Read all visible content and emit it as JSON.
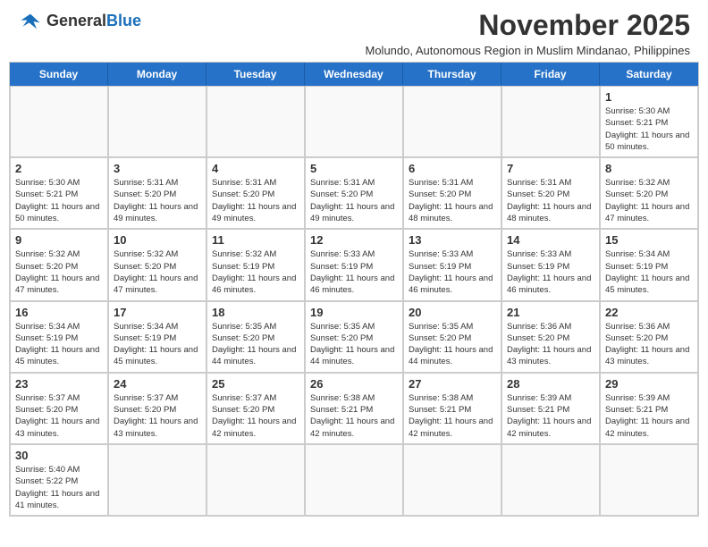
{
  "header": {
    "logo_general": "General",
    "logo_blue": "Blue",
    "month_title": "November 2025",
    "subtitle": "Molundo, Autonomous Region in Muslim Mindanao, Philippines"
  },
  "day_headers": [
    "Sunday",
    "Monday",
    "Tuesday",
    "Wednesday",
    "Thursday",
    "Friday",
    "Saturday"
  ],
  "weeks": [
    [
      {
        "day": "",
        "info": ""
      },
      {
        "day": "",
        "info": ""
      },
      {
        "day": "",
        "info": ""
      },
      {
        "day": "",
        "info": ""
      },
      {
        "day": "",
        "info": ""
      },
      {
        "day": "",
        "info": ""
      },
      {
        "day": "1",
        "info": "Sunrise: 5:30 AM\nSunset: 5:21 PM\nDaylight: 11 hours\nand 50 minutes."
      }
    ],
    [
      {
        "day": "2",
        "info": "Sunrise: 5:30 AM\nSunset: 5:21 PM\nDaylight: 11 hours\nand 50 minutes."
      },
      {
        "day": "3",
        "info": "Sunrise: 5:31 AM\nSunset: 5:20 PM\nDaylight: 11 hours\nand 49 minutes."
      },
      {
        "day": "4",
        "info": "Sunrise: 5:31 AM\nSunset: 5:20 PM\nDaylight: 11 hours\nand 49 minutes."
      },
      {
        "day": "5",
        "info": "Sunrise: 5:31 AM\nSunset: 5:20 PM\nDaylight: 11 hours\nand 49 minutes."
      },
      {
        "day": "6",
        "info": "Sunrise: 5:31 AM\nSunset: 5:20 PM\nDaylight: 11 hours\nand 48 minutes."
      },
      {
        "day": "7",
        "info": "Sunrise: 5:31 AM\nSunset: 5:20 PM\nDaylight: 11 hours\nand 48 minutes."
      },
      {
        "day": "8",
        "info": "Sunrise: 5:32 AM\nSunset: 5:20 PM\nDaylight: 11 hours\nand 47 minutes."
      }
    ],
    [
      {
        "day": "9",
        "info": "Sunrise: 5:32 AM\nSunset: 5:20 PM\nDaylight: 11 hours\nand 47 minutes."
      },
      {
        "day": "10",
        "info": "Sunrise: 5:32 AM\nSunset: 5:20 PM\nDaylight: 11 hours\nand 47 minutes."
      },
      {
        "day": "11",
        "info": "Sunrise: 5:32 AM\nSunset: 5:19 PM\nDaylight: 11 hours\nand 46 minutes."
      },
      {
        "day": "12",
        "info": "Sunrise: 5:33 AM\nSunset: 5:19 PM\nDaylight: 11 hours\nand 46 minutes."
      },
      {
        "day": "13",
        "info": "Sunrise: 5:33 AM\nSunset: 5:19 PM\nDaylight: 11 hours\nand 46 minutes."
      },
      {
        "day": "14",
        "info": "Sunrise: 5:33 AM\nSunset: 5:19 PM\nDaylight: 11 hours\nand 46 minutes."
      },
      {
        "day": "15",
        "info": "Sunrise: 5:34 AM\nSunset: 5:19 PM\nDaylight: 11 hours\nand 45 minutes."
      }
    ],
    [
      {
        "day": "16",
        "info": "Sunrise: 5:34 AM\nSunset: 5:19 PM\nDaylight: 11 hours\nand 45 minutes."
      },
      {
        "day": "17",
        "info": "Sunrise: 5:34 AM\nSunset: 5:19 PM\nDaylight: 11 hours\nand 45 minutes."
      },
      {
        "day": "18",
        "info": "Sunrise: 5:35 AM\nSunset: 5:20 PM\nDaylight: 11 hours\nand 44 minutes."
      },
      {
        "day": "19",
        "info": "Sunrise: 5:35 AM\nSunset: 5:20 PM\nDaylight: 11 hours\nand 44 minutes."
      },
      {
        "day": "20",
        "info": "Sunrise: 5:35 AM\nSunset: 5:20 PM\nDaylight: 11 hours\nand 44 minutes."
      },
      {
        "day": "21",
        "info": "Sunrise: 5:36 AM\nSunset: 5:20 PM\nDaylight: 11 hours\nand 43 minutes."
      },
      {
        "day": "22",
        "info": "Sunrise: 5:36 AM\nSunset: 5:20 PM\nDaylight: 11 hours\nand 43 minutes."
      }
    ],
    [
      {
        "day": "23",
        "info": "Sunrise: 5:37 AM\nSunset: 5:20 PM\nDaylight: 11 hours\nand 43 minutes."
      },
      {
        "day": "24",
        "info": "Sunrise: 5:37 AM\nSunset: 5:20 PM\nDaylight: 11 hours\nand 43 minutes."
      },
      {
        "day": "25",
        "info": "Sunrise: 5:37 AM\nSunset: 5:20 PM\nDaylight: 11 hours\nand 42 minutes."
      },
      {
        "day": "26",
        "info": "Sunrise: 5:38 AM\nSunset: 5:21 PM\nDaylight: 11 hours\nand 42 minutes."
      },
      {
        "day": "27",
        "info": "Sunrise: 5:38 AM\nSunset: 5:21 PM\nDaylight: 11 hours\nand 42 minutes."
      },
      {
        "day": "28",
        "info": "Sunrise: 5:39 AM\nSunset: 5:21 PM\nDaylight: 11 hours\nand 42 minutes."
      },
      {
        "day": "29",
        "info": "Sunrise: 5:39 AM\nSunset: 5:21 PM\nDaylight: 11 hours\nand 42 minutes."
      }
    ],
    [
      {
        "day": "30",
        "info": "Sunrise: 5:40 AM\nSunset: 5:22 PM\nDaylight: 11 hours\nand 41 minutes."
      },
      {
        "day": "",
        "info": ""
      },
      {
        "day": "",
        "info": ""
      },
      {
        "day": "",
        "info": ""
      },
      {
        "day": "",
        "info": ""
      },
      {
        "day": "",
        "info": ""
      },
      {
        "day": "",
        "info": ""
      }
    ]
  ]
}
